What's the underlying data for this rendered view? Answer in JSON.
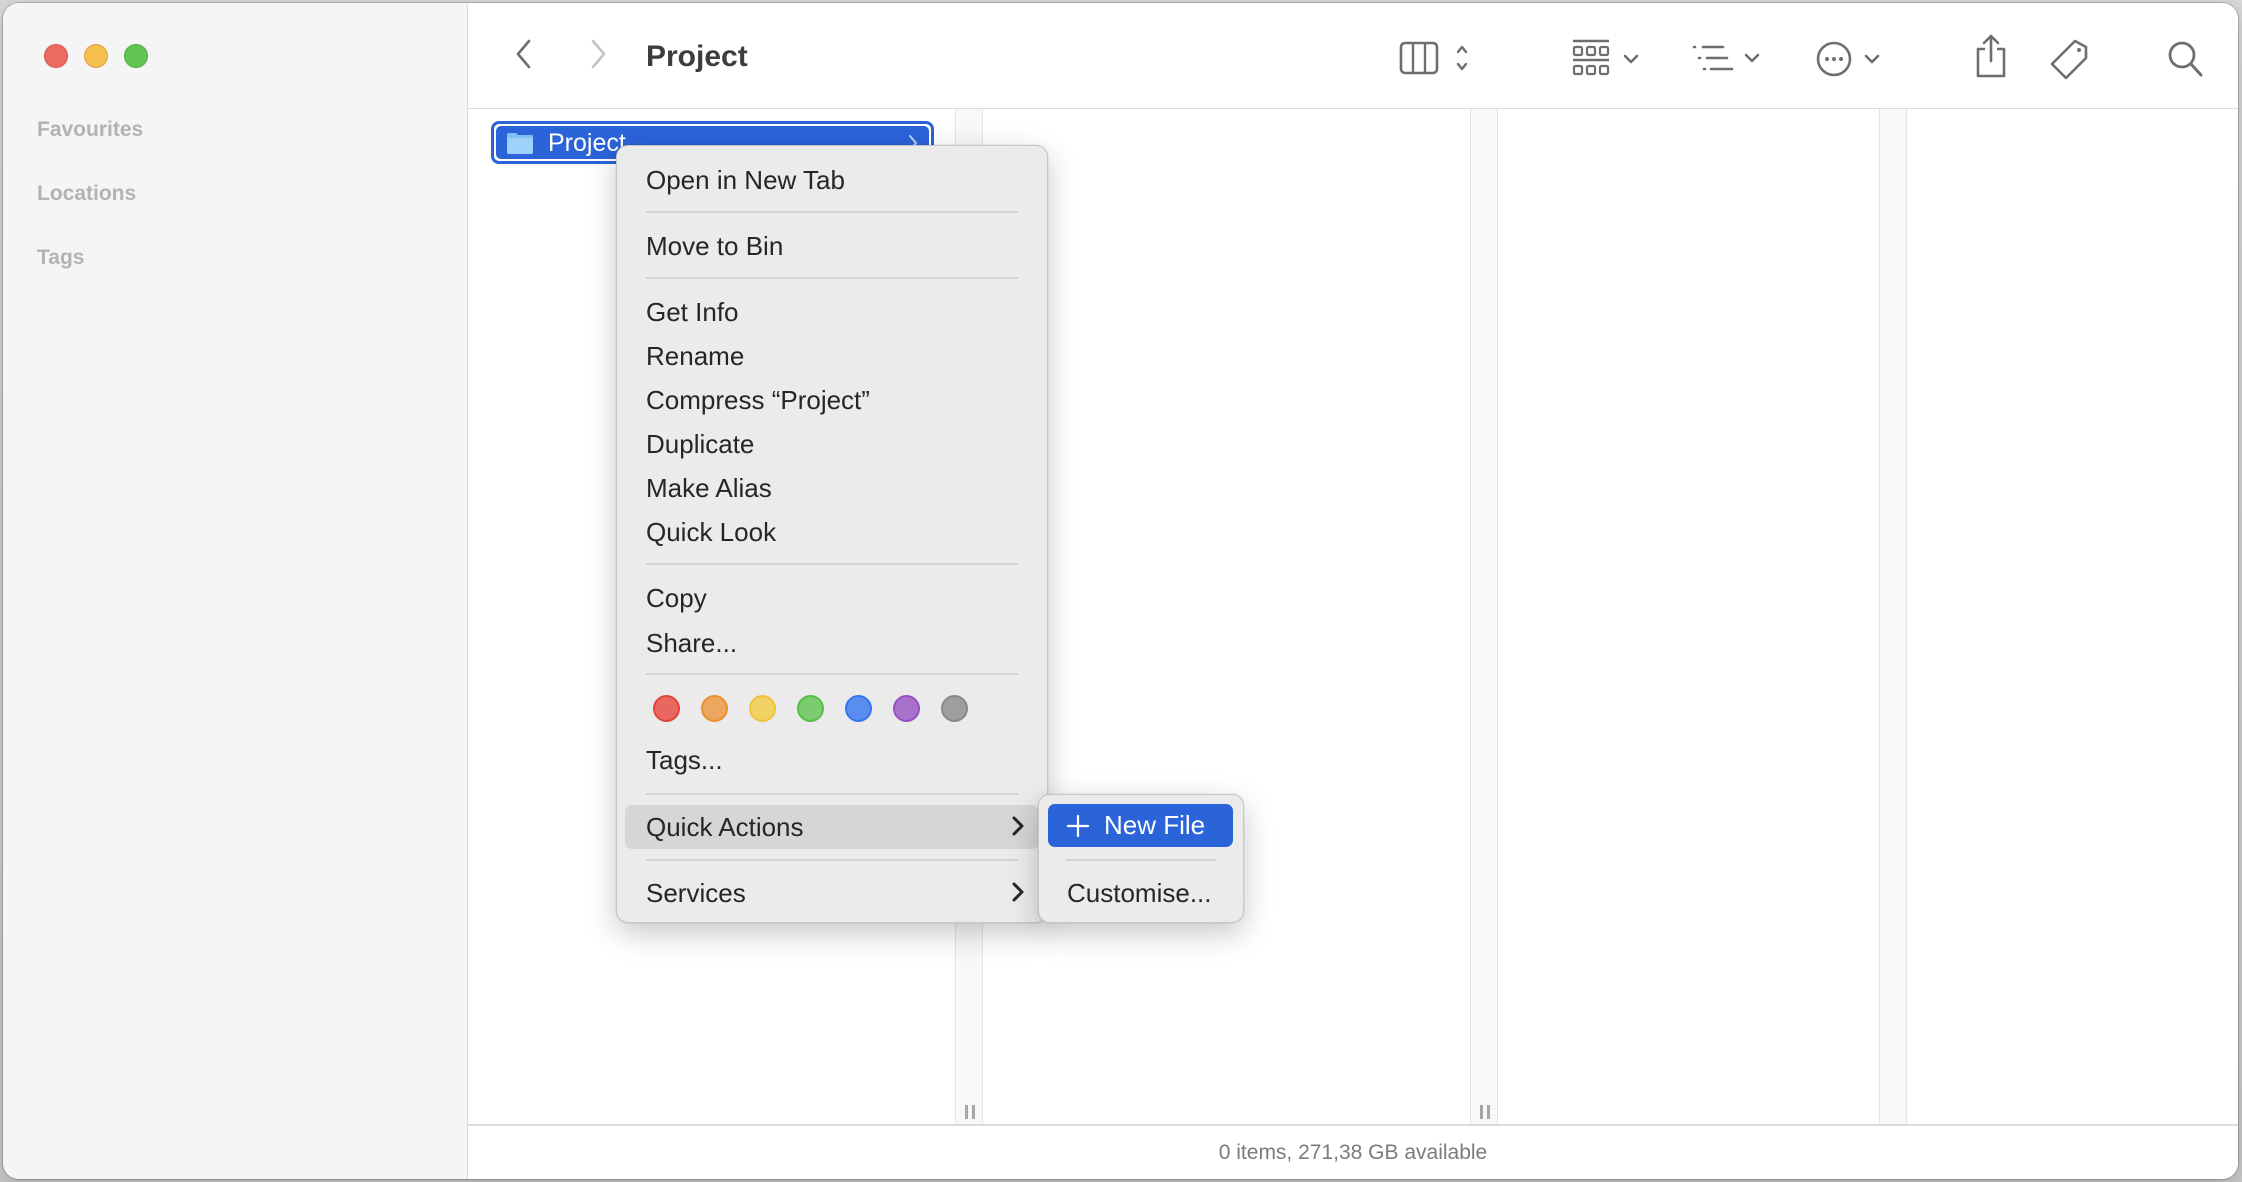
{
  "window": {
    "title": "Project",
    "traffic_lights": [
      "close",
      "minimize",
      "zoom"
    ]
  },
  "sidebar": {
    "sections": [
      {
        "label": "Favourites"
      },
      {
        "label": "Locations"
      },
      {
        "label": "Tags"
      }
    ]
  },
  "toolbar": {
    "back_icon": "chevron-left-icon",
    "forward_icon": "chevron-right-icon",
    "view_mode": "columns",
    "buttons": [
      {
        "name": "view-columns",
        "icon": "columns-icon"
      },
      {
        "name": "group",
        "icon": "grid-icon"
      },
      {
        "name": "sort",
        "icon": "list-icon"
      },
      {
        "name": "action",
        "icon": "ellipsis-circle-icon"
      },
      {
        "name": "share",
        "icon": "share-icon"
      },
      {
        "name": "tag",
        "icon": "tag-icon"
      },
      {
        "name": "search",
        "icon": "search-icon"
      }
    ]
  },
  "browser": {
    "selected_item": {
      "name": "Project",
      "type": "folder",
      "icon": "folder-icon"
    }
  },
  "status_bar": {
    "text": "0 items, 271,38 GB available"
  },
  "context_menu": {
    "items": [
      {
        "label": "Open in New Tab"
      },
      {
        "label": "Move to Bin"
      },
      {
        "label": "Get Info"
      },
      {
        "label": "Rename"
      },
      {
        "label": "Compress “Project”"
      },
      {
        "label": "Duplicate"
      },
      {
        "label": "Make Alias"
      },
      {
        "label": "Quick Look"
      },
      {
        "label": "Copy"
      },
      {
        "label": "Share..."
      },
      {
        "label": "Tags..."
      },
      {
        "label": "Quick Actions",
        "submenu": true,
        "highlighted": true
      },
      {
        "label": "Services",
        "submenu": true
      }
    ],
    "tag_colors": [
      {
        "name": "red",
        "fill": "#e8685f",
        "border": "#e0443a"
      },
      {
        "name": "orange",
        "fill": "#eda65e",
        "border": "#e8922e"
      },
      {
        "name": "yellow",
        "fill": "#f2d264",
        "border": "#efc33c"
      },
      {
        "name": "green",
        "fill": "#7acc6e",
        "border": "#59bd4a"
      },
      {
        "name": "blue",
        "fill": "#5a8df0",
        "border": "#3474ec"
      },
      {
        "name": "purple",
        "fill": "#a872cc",
        "border": "#9650c2"
      },
      {
        "name": "gray",
        "fill": "#9e9e9e",
        "border": "#888888"
      }
    ]
  },
  "quick_actions_submenu": {
    "items": [
      {
        "label": "New File",
        "icon": "plus-icon",
        "selected": true
      },
      {
        "label": "Customise..."
      }
    ]
  },
  "colors": {
    "accent": "#2b63d9",
    "menu_bg": "#ebebeb",
    "sidebar_bg": "#f5f5f5"
  }
}
